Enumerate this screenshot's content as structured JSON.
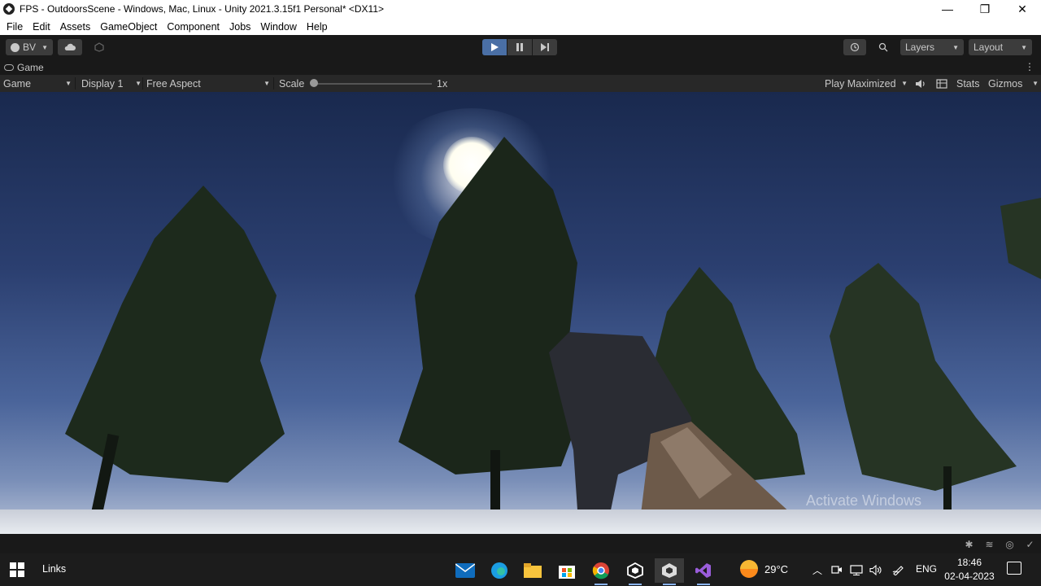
{
  "window": {
    "title": "FPS - OutdoorsScene - Windows, Mac, Linux - Unity 2021.3.15f1 Personal* <DX11>",
    "minimize": "—",
    "maximize": "❐",
    "close": "✕"
  },
  "menu": [
    "File",
    "Edit",
    "Assets",
    "GameObject",
    "Component",
    "Jobs",
    "Window",
    "Help"
  ],
  "toolbar": {
    "account_label": "BV",
    "layers_label": "Layers",
    "layout_label": "Layout",
    "play_state": "playing"
  },
  "game_tab": {
    "title": "Game"
  },
  "game_toolbar": {
    "view_mode": "Game",
    "display": "Display 1",
    "aspect": "Free Aspect",
    "scale_label": "Scale",
    "scale_value": "1x",
    "scale_fraction": 0.0,
    "play_mode": "Play Maximized",
    "stats": "Stats",
    "gizmos": "Gizmos"
  },
  "game_view": {
    "watermark": "Activate Windows"
  },
  "taskbar": {
    "links_label": "Links",
    "weather_temp": "29°C",
    "language": "ENG",
    "time": "18:46",
    "date": "02-04-2023",
    "apps": [
      "mail-icon",
      "edge-icon",
      "file-explorer-icon",
      "store-icon",
      "chrome-icon",
      "unity-hub-icon",
      "unity-editor-icon",
      "visual-studio-icon"
    ]
  },
  "colors": {
    "play_active": "#4a6fa5",
    "toolbar_bg": "#191919",
    "taskbar_bg": "#1c1c1c"
  }
}
